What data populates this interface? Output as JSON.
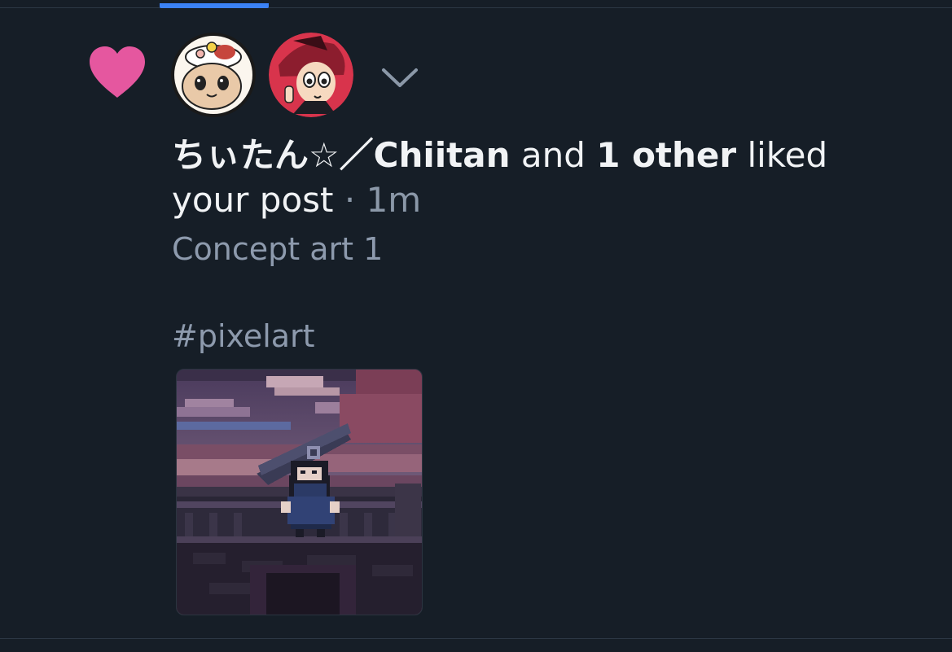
{
  "notification": {
    "type_icon": "heart-icon",
    "avatars": [
      {
        "name": "avatar-chiitan",
        "icon": "avatar-image"
      },
      {
        "name": "avatar-other",
        "icon": "avatar-image"
      }
    ],
    "expand_icon": "chevron-down-icon",
    "actor_name": "ちぃたん☆／Chiitan",
    "conjunction": " and ",
    "others": "1 other",
    "action": " liked your post",
    "separator": " · ",
    "time": "1m",
    "post_line_1": "Concept art 1",
    "post_line_2": "#pixelart"
  },
  "colors": {
    "background": "#161e27",
    "heart": "#e5579f",
    "accent": "#3b82f6",
    "primary_text": "#f1f3f5",
    "secondary_text": "#8d9aad"
  }
}
